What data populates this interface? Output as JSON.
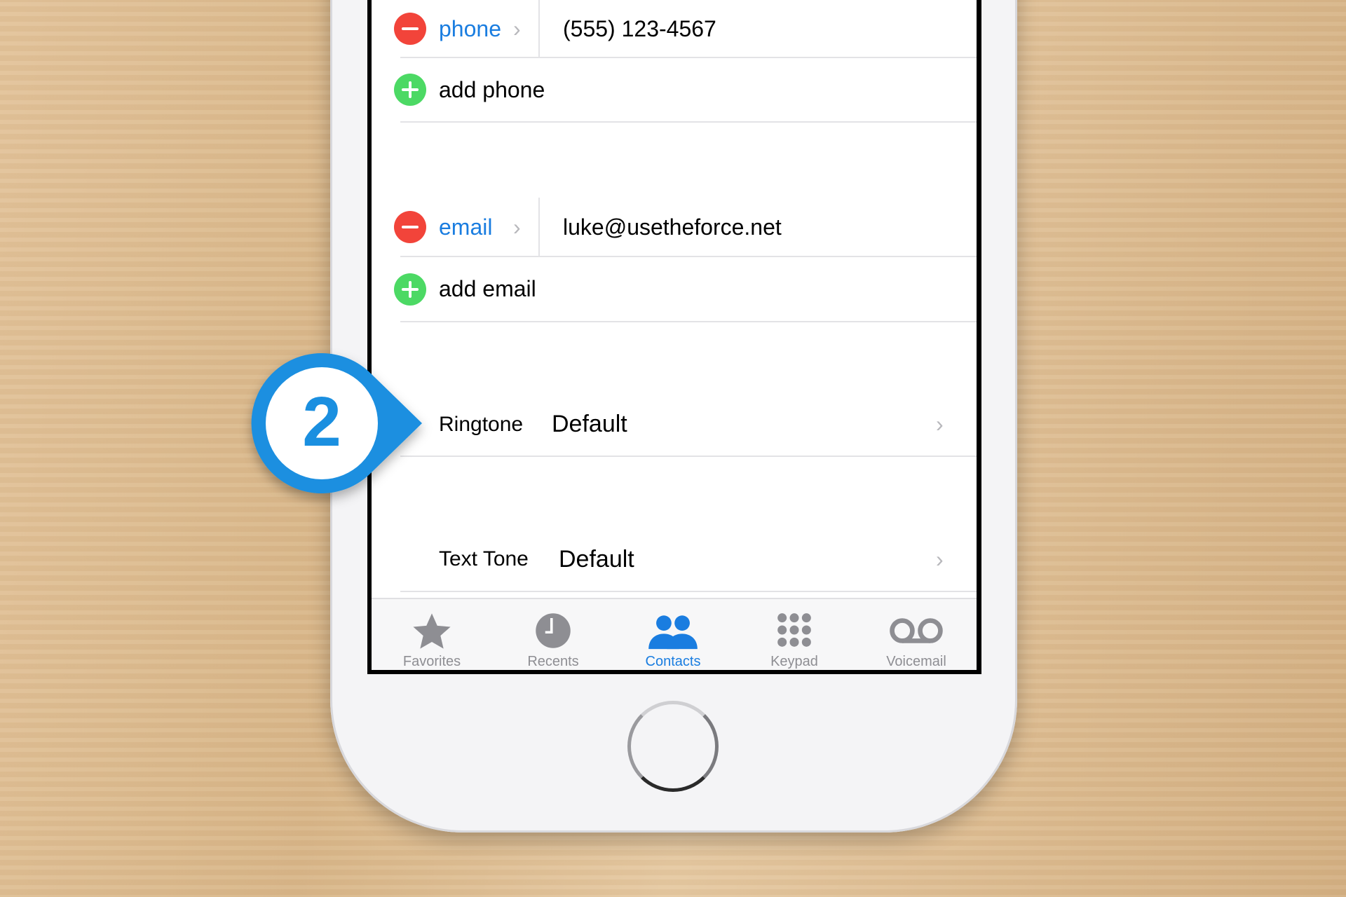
{
  "contact": {
    "phone": {
      "label": "phone",
      "value": "(555) 123-4567",
      "add_label": "add phone"
    },
    "email": {
      "label": "email",
      "value": "luke@usetheforce.net",
      "add_label": "add email"
    },
    "ringtone": {
      "label": "Ringtone",
      "value": "Default"
    },
    "text_tone": {
      "label": "Text Tone",
      "value": "Default"
    }
  },
  "tabbar": {
    "items": [
      {
        "label": "Favorites",
        "icon": "star-icon"
      },
      {
        "label": "Recents",
        "icon": "clock-icon"
      },
      {
        "label": "Contacts",
        "icon": "contacts-icon",
        "active": true
      },
      {
        "label": "Keypad",
        "icon": "keypad-icon"
      },
      {
        "label": "Voicemail",
        "icon": "voicemail-icon"
      }
    ]
  },
  "callout": {
    "step": "2",
    "color": "#1a8fe0"
  },
  "colors": {
    "accent": "#1a7de0",
    "delete": "#f2443a",
    "add": "#4cd964"
  }
}
